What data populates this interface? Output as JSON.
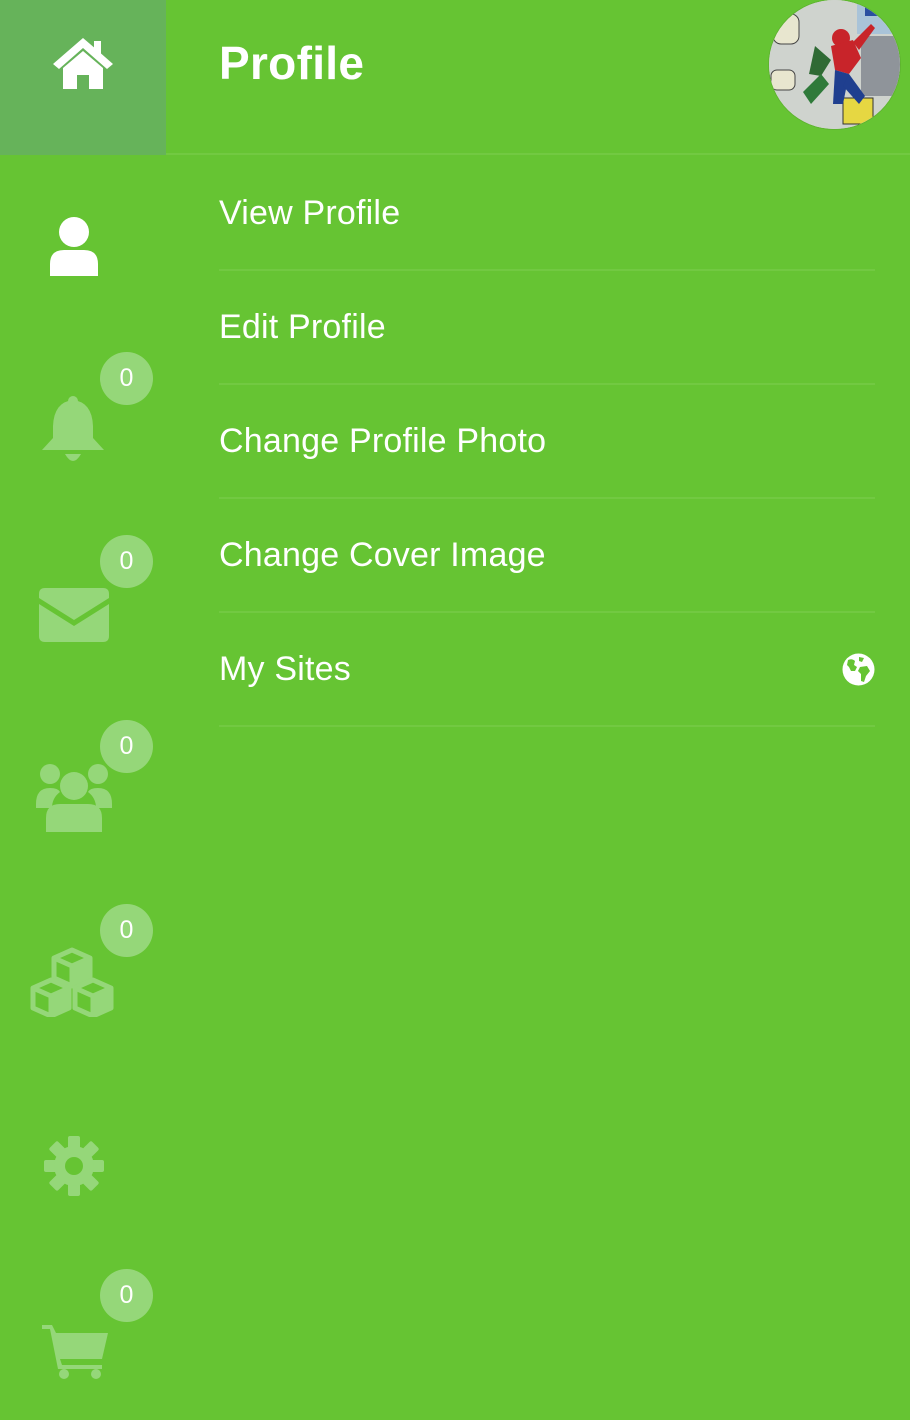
{
  "header": {
    "title": "Profile",
    "home_icon": "home-icon",
    "avatar_alt": "user-avatar"
  },
  "sidebar": {
    "items": [
      {
        "icon": "user-icon",
        "badge": null
      },
      {
        "icon": "bell-icon",
        "badge": "0"
      },
      {
        "icon": "envelope-icon",
        "badge": "0"
      },
      {
        "icon": "users-icon",
        "badge": "0"
      },
      {
        "icon": "cubes-icon",
        "badge": "0"
      },
      {
        "icon": "gear-icon",
        "badge": null
      },
      {
        "icon": "cart-icon",
        "badge": "0"
      }
    ]
  },
  "menu": {
    "items": [
      {
        "label": "View Profile"
      },
      {
        "label": "Edit Profile"
      },
      {
        "label": "Change Profile Photo"
      },
      {
        "label": "Change Cover Image"
      },
      {
        "label": "My Sites",
        "icon": "globe-icon"
      }
    ]
  },
  "colors": {
    "background": "#66c433",
    "home_box": "#66b35a",
    "active_icon": "#ffffff",
    "inactive_icon": "#95d779",
    "badge": "#95d779",
    "divider": "#72c942"
  }
}
